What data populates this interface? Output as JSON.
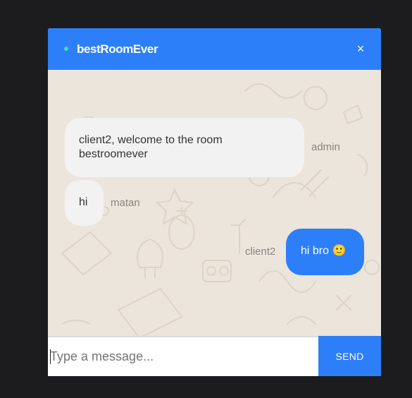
{
  "header": {
    "title": "bestRoomEver",
    "close_label": "×"
  },
  "messages": [
    {
      "sender": "admin",
      "text": "client2, welcome to the room bestroomever",
      "own": false
    },
    {
      "sender": "matan",
      "text": "hi",
      "own": false
    },
    {
      "sender": "client2",
      "text": "hi bro 🙂",
      "own": true
    }
  ],
  "composer": {
    "placeholder": "Type a message...",
    "value": "",
    "send_label": "SEND"
  },
  "colors": {
    "accent": "#2d7ff9",
    "online": "#4ad7b5",
    "chat_background": "#ece5dc",
    "page_background": "#1c1c1e"
  },
  "icons": {
    "online": "online-status-dot",
    "close": "close-icon",
    "emoji": "slightly-smiling-face"
  }
}
